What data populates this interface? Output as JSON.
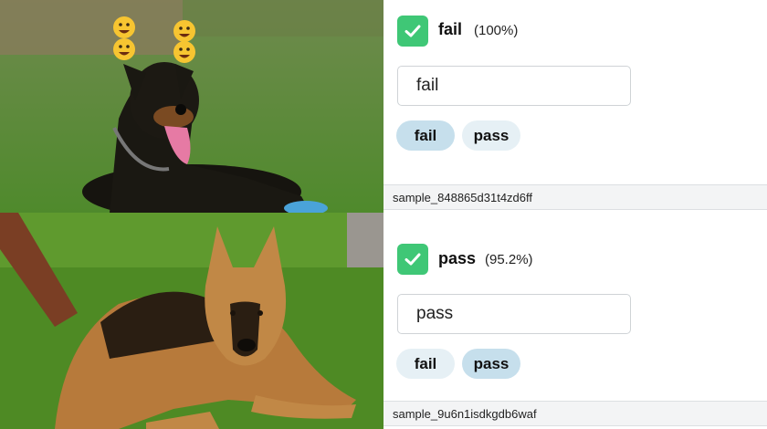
{
  "samples": [
    {
      "image_description_icon": "doberman-photo",
      "label": "fail",
      "confidence": "(100%)",
      "input_value": "fail",
      "chips": [
        "fail",
        "pass"
      ],
      "active_chip": "fail",
      "sample_id": "sample_848865d31t4zd6ff",
      "overlay_icon": "smiley-emoji-icon"
    },
    {
      "image_description_icon": "german-shepherd-photo",
      "label": "pass",
      "confidence": "(95.2%)",
      "input_value": "pass",
      "chips": [
        "fail",
        "pass"
      ],
      "active_chip": "pass",
      "sample_id": "sample_9u6n1isdkgdb6waf"
    }
  ],
  "colors": {
    "check": "#3fc776",
    "chip_active": "#c6dfec",
    "chip_inactive": "#e6f0f5"
  }
}
